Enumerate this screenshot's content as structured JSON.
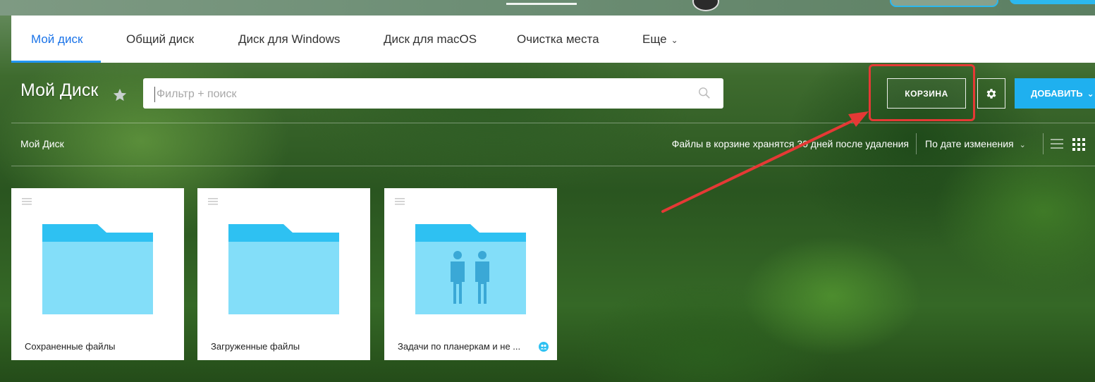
{
  "nav": {
    "tabs": [
      {
        "label": "Мой диск",
        "active": true
      },
      {
        "label": "Общий диск"
      },
      {
        "label": "Диск для Windows"
      },
      {
        "label": "Диск для macOS"
      },
      {
        "label": "Очистка места"
      },
      {
        "label": "Еще"
      }
    ]
  },
  "header": {
    "title": "Мой Диск",
    "search_placeholder": "Фильтр + поиск",
    "trash_label": "КОРЗИНА",
    "add_label": "ДОБАВИТЬ"
  },
  "toolbar": {
    "breadcrumb": "Мой Диск",
    "trash_note": "Файлы в корзине хранятся 30 дней после удаления",
    "sort_label": "По дате изменения"
  },
  "folders": [
    {
      "name": "Сохраненные файлы",
      "shared": false
    },
    {
      "name": "Загруженные файлы",
      "shared": false
    },
    {
      "name": "Задачи по планеркам и не ...",
      "shared": true
    }
  ],
  "colors": {
    "accent": "#1fb0ef",
    "active_tab": "#1a73e8",
    "folder_top": "#2ec1f2",
    "folder_body": "#83def9",
    "highlight": "#e53935"
  }
}
